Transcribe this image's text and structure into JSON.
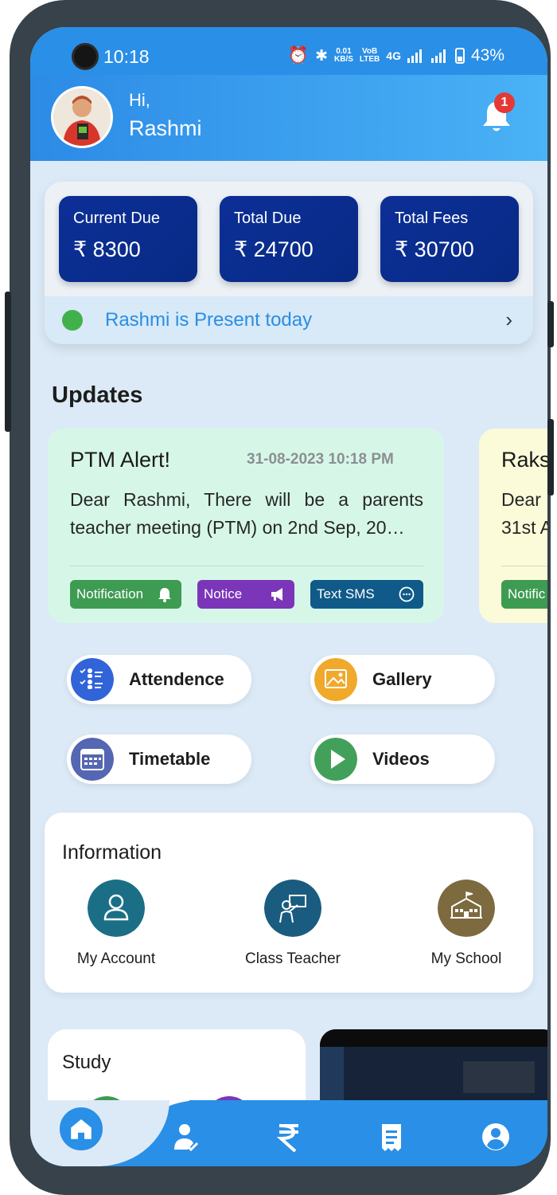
{
  "status_bar": {
    "time": "10:18",
    "net_speed_value": "0.01",
    "net_speed_unit": "KB/S",
    "volte_top": "VoB",
    "volte_bottom": "LTEB",
    "network": "4G",
    "battery": "43%"
  },
  "header": {
    "greeting": "Hi,",
    "name": "Rashmi",
    "notification_count": "1"
  },
  "fees": {
    "items": [
      {
        "label": "Current Due",
        "value": "₹ 8300"
      },
      {
        "label": "Total Due",
        "value": "₹ 24700"
      },
      {
        "label": "Total Fees",
        "value": "₹ 30700"
      }
    ],
    "attendance_text": "Rashmi is Present today"
  },
  "updates": {
    "title": "Updates",
    "cards": [
      {
        "title": "PTM Alert!",
        "date": "31-08-2023 10:18 PM",
        "body": "Dear Rashmi, There will be a parents teacher meeting (PTM) on 2nd Sep, 20…",
        "tags": [
          "Notification",
          "Notice",
          "Text SMS"
        ]
      },
      {
        "title": "Raks",
        "body_line1": "Dear",
        "body_line2": "31st A",
        "tag": "Notific"
      }
    ]
  },
  "quick_links": [
    "Attendence",
    "Gallery",
    "Timetable",
    "Videos"
  ],
  "information": {
    "title": "Information",
    "items": [
      "My Account",
      "Class Teacher",
      "My School"
    ]
  },
  "study": {
    "title": "Study"
  },
  "colors": {
    "primary": "#2a8fe6",
    "fee_box": "#0c2f97",
    "present_green": "#41b24b",
    "notification_pill": "#3e9b52",
    "notice_pill": "#7b35b8",
    "sms_pill": "#0f5a88"
  }
}
